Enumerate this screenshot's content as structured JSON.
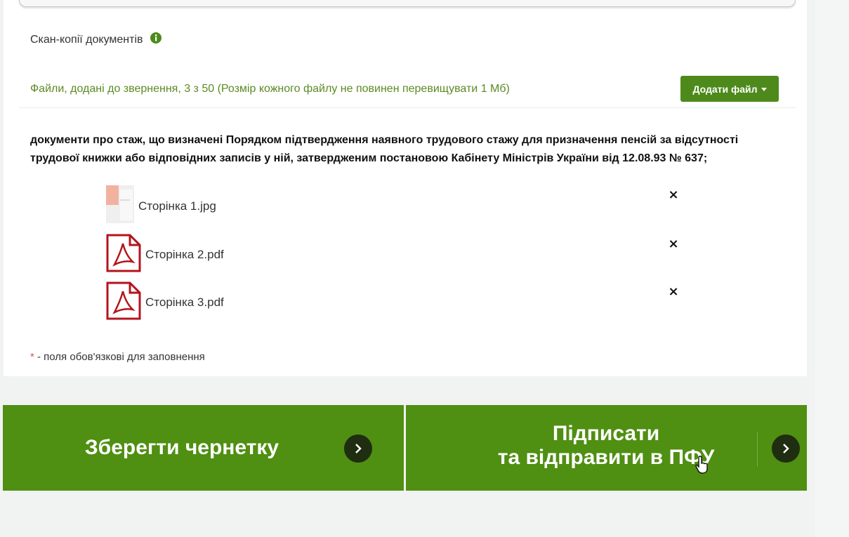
{
  "section": {
    "title": "Скан-копії документів",
    "info_icon": "info-icon"
  },
  "files": {
    "note": "Файли, додані до звернення, 3 з 50 (Розмір кожного файлу не повинен перевищувати 1 Мб)",
    "add_button_label": "Додати файл"
  },
  "document": {
    "description": "документи про стаж, що визначені Порядком підтвердження наявного трудового стажу для призначення пенсій за відсутності трудової книжки або відповідних записів у ній, затвердженим постановою Кабінету Міністрів України від 12.08.93 № 637;",
    "items": [
      {
        "name": "Сторінка 1.jpg",
        "icon": "image-thumbnail-icon",
        "remove": "×"
      },
      {
        "name": "Сторінка 2.pdf",
        "icon": "pdf-file-icon",
        "remove": "×"
      },
      {
        "name": "Сторінка 3.pdf",
        "icon": "pdf-file-icon",
        "remove": "×"
      }
    ]
  },
  "required_note": {
    "asterisk": "*",
    "text": " - поля обов'язкові для заповнення"
  },
  "actions": {
    "save_label": "Зберегти чернетку",
    "sign_label_line1": "Підписати",
    "sign_label_line2": "та відправити в ПФУ"
  },
  "colors": {
    "accent_green": "#4f8f12",
    "note_green": "#5b8a24",
    "pdf_red": "#b3141d",
    "required_red": "#d9534f"
  }
}
